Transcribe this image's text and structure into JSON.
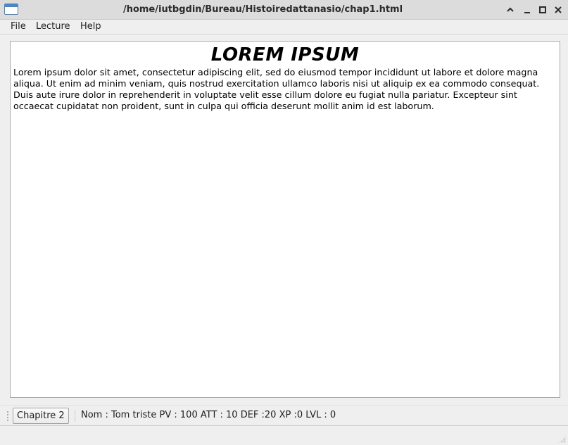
{
  "window": {
    "title": "/home/iutbgdin/Bureau/Histoiredattanasio/chap1.html"
  },
  "menubar": {
    "items": [
      {
        "label": "File"
      },
      {
        "label": "Lecture"
      },
      {
        "label": "Help"
      }
    ]
  },
  "content": {
    "heading": "LOREM IPSUM",
    "paragraph": "Lorem ipsum dolor sit amet, consectetur adipiscing elit, sed do eiusmod tempor incididunt ut labore et dolore magna aliqua. Ut enim ad minim veniam, quis nostrud exercitation ullamco laboris nisi ut aliquip ex ea commodo consequat. Duis aute irure dolor in reprehenderit in voluptate velit esse cillum dolore eu fugiat nulla pariatur. Excepteur sint occaecat cupidatat non proident, sunt in culpa qui officia deserunt mollit anim id est laborum."
  },
  "toolbar": {
    "chapter_button_label": "Chapitre 2",
    "player_stats": "Nom : Tom triste PV : 100 ATT : 10 DEF :20 XP :0 LVL : 0"
  },
  "icons": {
    "app": "application-window-icon",
    "maximize_arrow": "chevron-up-icon",
    "minimize": "minimize-icon",
    "restore": "maximize-square-icon",
    "close": "close-icon",
    "toolbar_grip": "grip-dots-icon",
    "size_grip": "resize-grip-icon"
  },
  "colors": {
    "window_bg": "#efefef",
    "titlebar_bg": "#dcdcdc",
    "content_bg": "#ffffff",
    "app_icon_accent": "#4d86c6"
  }
}
